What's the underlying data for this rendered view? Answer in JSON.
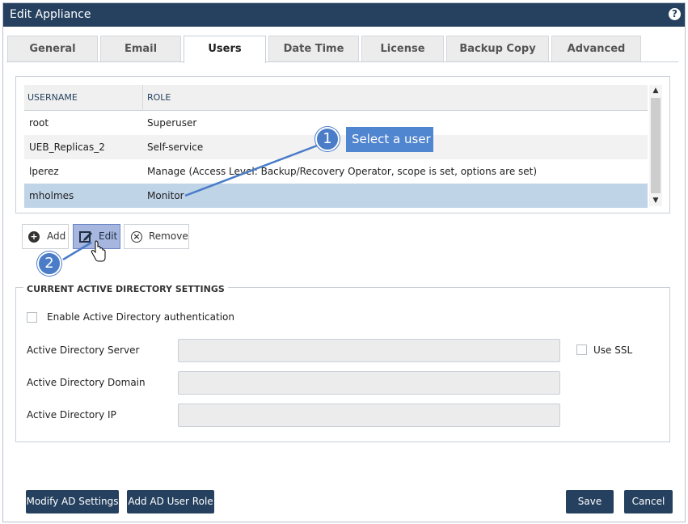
{
  "window": {
    "title": "Edit Appliance",
    "help_glyph": "?"
  },
  "tabs": [
    {
      "label": "General"
    },
    {
      "label": "Email"
    },
    {
      "label": "Users"
    },
    {
      "label": "Date Time"
    },
    {
      "label": "License"
    },
    {
      "label": "Backup Copy"
    },
    {
      "label": "Advanced"
    }
  ],
  "active_tab": "Users",
  "users_table": {
    "headers": {
      "username": "USERNAME",
      "role": "ROLE"
    },
    "rows": [
      {
        "username": "root",
        "role": "Superuser"
      },
      {
        "username": "UEB_Replicas_2",
        "role": "Self-service"
      },
      {
        "username": "lperez",
        "role": "Manage (Access Level: Backup/Recovery Operator, scope is set, options are set)"
      },
      {
        "username": "mholmes",
        "role": "Monitor"
      }
    ],
    "selected_row": 3
  },
  "user_actions": {
    "add": "Add",
    "edit": "Edit",
    "remove": "Remove"
  },
  "ad_settings": {
    "section_title": "CURRENT ACTIVE DIRECTORY SETTINGS",
    "enable_label": "Enable Active Directory authentication",
    "server_label": "Active Directory Server",
    "server_value": "",
    "use_ssl_label": "Use SSL",
    "domain_label": "Active Directory Domain",
    "domain_value": "",
    "ip_label": "Active Directory IP",
    "ip_value": ""
  },
  "footer": {
    "modify_ad": "Modify AD Settings",
    "add_ad_role": "Add AD User Role",
    "save": "Save",
    "cancel": "Cancel"
  },
  "callouts": {
    "step1_number": "1",
    "step1_text": "Select a user",
    "step2_number": "2"
  },
  "colors": {
    "titlebar": "#25415f",
    "selected_row": "#c0d4e8",
    "callout": "#4a7cc8",
    "primary_button": "#25415f"
  }
}
